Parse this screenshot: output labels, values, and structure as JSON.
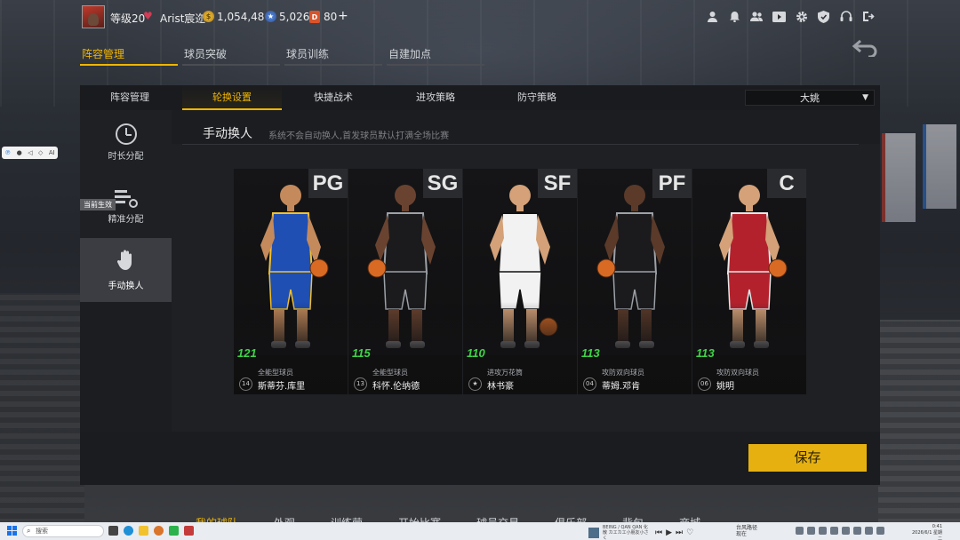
{
  "header": {
    "level": "等级20",
    "username": "Arist宸迩",
    "gold": "1,054,486",
    "stars": "5,026",
    "tickets": "80",
    "plus": "+"
  },
  "main_tabs": [
    "阵容管理",
    "球员突破",
    "球员训练",
    "自建加点"
  ],
  "sub_tabs": [
    "阵容管理",
    "轮换设置",
    "快捷战术",
    "进攻策略",
    "防守策略"
  ],
  "dropdown": {
    "selected": "大姚"
  },
  "left_menu": {
    "items": [
      "时长分配",
      "精准分配",
      "手动换人"
    ],
    "current_badge": "当前生效"
  },
  "section": {
    "title": "手动换人",
    "description": "系统不会自动换人,首发球员默认打满全场比赛"
  },
  "players": [
    {
      "position": "PG",
      "rating": "121",
      "role": "全能型球员",
      "jersey": "14",
      "name": "斯蒂芬.库里",
      "colors": {
        "jersey": "#1f4fb3",
        "trim": "#f2c12e",
        "skin": "#c48a5c"
      }
    },
    {
      "position": "SG",
      "rating": "115",
      "role": "全能型球员",
      "jersey": "13",
      "name": "科怀.伦纳德",
      "colors": {
        "jersey": "#1b1b1d",
        "trim": "#9da2a8",
        "skin": "#6a4330"
      }
    },
    {
      "position": "SF",
      "rating": "110",
      "role": "进攻万花筒",
      "jersey": "★",
      "name": "林书豪",
      "colors": {
        "jersey": "#f2f2f2",
        "trim": "#111111",
        "skin": "#d4a178"
      }
    },
    {
      "position": "PF",
      "rating": "113",
      "role": "攻防双向球员",
      "jersey": "04",
      "name": "蒂姆.邓肯",
      "colors": {
        "jersey": "#1b1b1d",
        "trim": "#9da2a8",
        "skin": "#5b3a2a"
      }
    },
    {
      "position": "C",
      "rating": "113",
      "role": "攻防双向球员",
      "jersey": "06",
      "name": "姚明",
      "colors": {
        "jersey": "#b3222c",
        "trim": "#e8e8e8",
        "skin": "#d4a178"
      }
    }
  ],
  "save_button": "保存",
  "bottom_nav": [
    "我的球队",
    "外观",
    "训练营",
    "开始比赛",
    "球员交易",
    "俱乐部",
    "背包",
    "商城"
  ],
  "taskbar": {
    "search_placeholder": "搜索",
    "media_title": "BEING / QAN QAN 化散 カエカエ小朋友小さく",
    "weather_line1": "台风路径",
    "weather_line2": "现在",
    "time": "0:41",
    "date": "2026/6/1 星期二"
  },
  "colors": {
    "accent": "#f0b500",
    "rating": "#3fd447",
    "save": "#e6b110"
  }
}
